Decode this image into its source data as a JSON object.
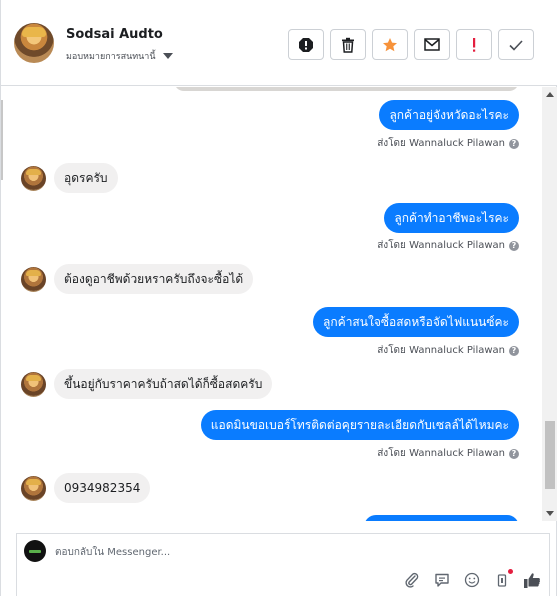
{
  "header": {
    "name": "Sodsai Audto",
    "assign_label": "มอบหมายการสนทนานี้"
  },
  "toolbar": {
    "buttons": [
      {
        "icon": "alert-octagon-icon"
      },
      {
        "icon": "trash-icon"
      },
      {
        "icon": "star-icon",
        "color": "#f7923a"
      },
      {
        "icon": "envelope-icon"
      },
      {
        "icon": "exclamation-icon",
        "color": "#e41e3f"
      },
      {
        "icon": "checkmark-icon"
      }
    ]
  },
  "messages": [
    {
      "direction": "out",
      "text": "ลูกค้าอยู่จังหวัดอะไรคะ",
      "sent_by": "ส่งโดย Wannaluck Pilawan"
    },
    {
      "direction": "in",
      "text": "อุดรครับ"
    },
    {
      "direction": "out",
      "text": "ลูกค้าทำอาชีพอะไรคะ",
      "sent_by": "ส่งโดย Wannaluck Pilawan"
    },
    {
      "direction": "in",
      "text": "ต้องดูอาชีพด้วยหราครับถึงจะซื้อได้"
    },
    {
      "direction": "out",
      "text": "ลูกค้าสนใจซื้อสดหรือจัดไฟแนนซ์คะ",
      "sent_by": "ส่งโดย Wannaluck Pilawan"
    },
    {
      "direction": "in",
      "text": "ขึ้นอยู่กับราคาครับถ้าสดได้ก็ซื้อสดครับ"
    },
    {
      "direction": "out",
      "text": "แอดมินขอเบอร์โทรติดต่อคุยรายละเอียดกับเซลล์ได้ไหมคะ",
      "sent_by": "ส่งโดย Wannaluck Pilawan"
    },
    {
      "direction": "in",
      "text": "0934982354"
    }
  ],
  "composer": {
    "placeholder": "ตอบกลับใน Messenger...",
    "icons": [
      "paperclip-icon",
      "chat-bubble-icon",
      "smiley-icon",
      "tag-icon",
      "thumbs-up-icon"
    ]
  },
  "colors": {
    "outgoing_bubble": "#0a7cff",
    "incoming_bubble": "#f1f0f0",
    "like_color": "#4b4f56"
  }
}
